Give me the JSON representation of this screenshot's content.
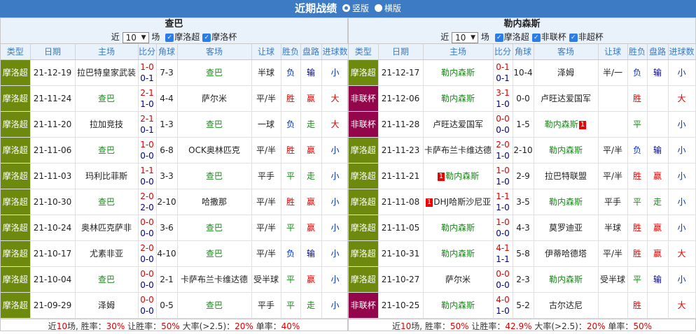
{
  "title": "近期战绩",
  "layout_opts": [
    "竖版",
    "横版"
  ],
  "layout_selected": 0,
  "labels": {
    "near": "近",
    "chang": "场"
  },
  "columns": [
    "类型",
    "日期",
    "主场",
    "比分",
    "角球",
    "客场",
    "让球",
    "胜负",
    "盘路",
    "进球数"
  ],
  "colors": {
    "mocha": "#6d8a0f",
    "nonleague": "#94064b",
    "win": "#e00000",
    "draw": "#1a8a1a",
    "lose": "#0033cc"
  },
  "left": {
    "team": "查巴",
    "count": "10",
    "filters": [
      "摩洛超",
      "摩洛杯"
    ],
    "rows": [
      {
        "type": "摩洛超",
        "date": "21-12-19",
        "home": "拉巴特皇家武装",
        "ft": "1-0",
        "ht": "0-1",
        "ftc": "red",
        "htc": "navy",
        "corner": "7-3",
        "away": "查巴",
        "hc": "",
        "awc": "green",
        "handicap": "半球",
        "wl": "负",
        "wlc": "blue",
        "pan": "输",
        "panc": "navy",
        "goals": "小",
        "goalsc": "blue"
      },
      {
        "type": "摩洛超",
        "date": "21-11-24",
        "home": "查巴",
        "ft": "2-1",
        "ht": "1-0",
        "ftc": "red",
        "htc": "navy",
        "corner": "4-4",
        "away": "萨尔米",
        "hc": "green",
        "awc": "",
        "handicap": "平/半",
        "wl": "胜",
        "wlc": "red",
        "pan": "赢",
        "panc": "red",
        "goals": "大",
        "goalsc": "red"
      },
      {
        "type": "摩洛超",
        "date": "21-11-20",
        "home": "拉加竞技",
        "ft": "2-1",
        "ht": "0-1",
        "ftc": "red",
        "htc": "navy",
        "corner": "1-3",
        "away": "查巴",
        "hc": "",
        "awc": "green",
        "handicap": "一球",
        "wl": "负",
        "wlc": "blue",
        "pan": "走",
        "panc": "green",
        "goals": "大",
        "goalsc": "red"
      },
      {
        "type": "摩洛超",
        "date": "21-11-06",
        "home": "查巴",
        "ft": "1-0",
        "ht": "0-0",
        "ftc": "red",
        "htc": "navy",
        "corner": "6-8",
        "away": "OCK奥林匹克",
        "hc": "green",
        "awc": "",
        "handicap": "平/半",
        "wl": "胜",
        "wlc": "red",
        "pan": "赢",
        "panc": "red",
        "goals": "小",
        "goalsc": "blue"
      },
      {
        "type": "摩洛超",
        "date": "21-11-03",
        "home": "玛利比菲斯",
        "ft": "1-1",
        "ht": "0-0",
        "ftc": "red",
        "htc": "navy",
        "corner": "3-3",
        "away": "查巴",
        "hc": "",
        "awc": "green",
        "handicap": "平手",
        "wl": "平",
        "wlc": "green",
        "pan": "走",
        "panc": "green",
        "goals": "小",
        "goalsc": "blue"
      },
      {
        "type": "摩洛超",
        "date": "21-10-30",
        "home": "查巴",
        "ft": "2-0",
        "ht": "2-0",
        "ftc": "red",
        "htc": "navy",
        "corner": "2-10",
        "away": "哈撒那",
        "hc": "green",
        "awc": "",
        "handicap": "平/半",
        "wl": "胜",
        "wlc": "red",
        "pan": "赢",
        "panc": "red",
        "goals": "小",
        "goalsc": "blue"
      },
      {
        "type": "摩洛超",
        "date": "21-10-24",
        "home": "奥林匹克萨非",
        "ft": "0-0",
        "ht": "0-0",
        "ftc": "red",
        "htc": "navy",
        "corner": "3-6",
        "away": "查巴",
        "hc": "",
        "awc": "green",
        "handicap": "平/半",
        "wl": "平",
        "wlc": "green",
        "pan": "赢",
        "panc": "red",
        "goals": "小",
        "goalsc": "blue"
      },
      {
        "type": "摩洛超",
        "date": "21-10-17",
        "home": "尤素非亚",
        "ft": "2-0",
        "ht": "0-0",
        "ftc": "red",
        "htc": "navy",
        "corner": "4-10",
        "away": "查巴",
        "hc": "",
        "awc": "green",
        "handicap": "平/半",
        "wl": "负",
        "wlc": "blue",
        "pan": "输",
        "panc": "navy",
        "goals": "小",
        "goalsc": "blue"
      },
      {
        "type": "摩洛超",
        "date": "21-10-04",
        "home": "查巴",
        "ft": "0-0",
        "ht": "0-0",
        "ftc": "red",
        "htc": "navy",
        "corner": "2-1",
        "away": "卡萨布兰卡维达德",
        "hc": "green",
        "awc": "",
        "handicap": "受半球",
        "wl": "平",
        "wlc": "green",
        "pan": "赢",
        "panc": "red",
        "goals": "小",
        "goalsc": "blue"
      },
      {
        "type": "摩洛超",
        "date": "21-09-29",
        "home": "泽姆",
        "ft": "0-0",
        "ht": "0-0",
        "ftc": "red",
        "htc": "navy",
        "corner": "0-5",
        "away": "查巴",
        "hc": "",
        "awc": "green",
        "handicap": "平手",
        "wl": "平",
        "wlc": "green",
        "pan": "走",
        "panc": "green",
        "goals": "小",
        "goalsc": "blue"
      }
    ],
    "footer": {
      "p1": "近",
      "n": "10",
      "p2": "场, 胜率：",
      "win": "30%",
      "p3": "让胜率：",
      "hwin": "50%",
      "p4": "大率(>2.5)：",
      "big": "20%",
      "p5": "单率：",
      "odd": "40%"
    }
  },
  "right": {
    "team": "勒内森斯",
    "count": "10",
    "filters": [
      "摩洛超",
      "非联杯",
      "非超杯"
    ],
    "rows": [
      {
        "type": "摩洛超",
        "date": "21-12-17",
        "home": "勒内森斯",
        "ft": "0-1",
        "ht": "0-1",
        "ftc": "red",
        "htc": "navy",
        "corner": "10-4",
        "away": "泽姆",
        "hc": "green",
        "awc": "",
        "handicap": "半/一",
        "wl": "负",
        "wlc": "blue",
        "pan": "输",
        "panc": "navy",
        "goals": "小",
        "goalsc": "blue"
      },
      {
        "type": "非联杯",
        "date": "21-12-06",
        "home": "勒内森斯",
        "ft": "3-1",
        "ht": "1-0",
        "ftc": "red",
        "htc": "navy",
        "corner": "0-0",
        "away": "卢旺达爱国军",
        "hc": "green",
        "awc": "",
        "handicap": "",
        "wl": "胜",
        "wlc": "red",
        "pan": "",
        "panc": "",
        "goals": "大",
        "goalsc": "red"
      },
      {
        "type": "非联杯",
        "date": "21-11-28",
        "home": "卢旺达爱国军",
        "ft": "0-0",
        "ht": "0-0",
        "ftc": "red",
        "htc": "navy",
        "corner": "1-5",
        "away": "勒内森斯",
        "hc": "",
        "awc": "green",
        "awr": "1",
        "handicap": "",
        "wl": "平",
        "wlc": "green",
        "pan": "",
        "panc": "",
        "goals": "小",
        "goalsc": "blue"
      },
      {
        "type": "摩洛超",
        "date": "21-11-23",
        "home": "卡萨布兰卡维达德",
        "ft": "2-0",
        "ht": "1-0",
        "ftc": "red",
        "htc": "navy",
        "corner": "2-10",
        "away": "勒内森斯",
        "hc": "",
        "awc": "green",
        "handicap": "平/半",
        "wl": "负",
        "wlc": "blue",
        "pan": "输",
        "panc": "navy",
        "goals": "小",
        "goalsc": "blue"
      },
      {
        "type": "摩洛超",
        "date": "21-11-21",
        "home": "勒内森斯",
        "hr": "1",
        "ft": "1-0",
        "ht": "1-0",
        "ftc": "red",
        "htc": "navy",
        "corner": "2-9",
        "away": "拉巴特联盟",
        "hc": "green",
        "awc": "",
        "handicap": "平/半",
        "wl": "胜",
        "wlc": "red",
        "pan": "赢",
        "panc": "red",
        "goals": "小",
        "goalsc": "blue"
      },
      {
        "type": "摩洛超",
        "date": "21-11-08",
        "home": "DHJ哈斯沙尼亚",
        "hr": "1",
        "ft": "1-1",
        "ht": "1-0",
        "ftc": "red",
        "htc": "navy",
        "corner": "3-5",
        "away": "勒内森斯",
        "hc": "",
        "awc": "green",
        "handicap": "平手",
        "wl": "平",
        "wlc": "green",
        "pan": "走",
        "panc": "green",
        "goals": "小",
        "goalsc": "blue"
      },
      {
        "type": "摩洛超",
        "date": "21-11-05",
        "home": "勒内森斯",
        "ft": "1-0",
        "ht": "0-0",
        "ftc": "red",
        "htc": "navy",
        "corner": "4-3",
        "away": "莫罗迪亚",
        "hc": "green",
        "awc": "",
        "handicap": "半球",
        "wl": "胜",
        "wlc": "red",
        "pan": "赢",
        "panc": "red",
        "goals": "小",
        "goalsc": "blue"
      },
      {
        "type": "摩洛超",
        "date": "21-10-31",
        "home": "勒内森斯",
        "ft": "4-1",
        "ht": "1-1",
        "ftc": "red",
        "htc": "navy",
        "corner": "5-8",
        "away": "伊蒂哈德塔",
        "hc": "green",
        "awc": "",
        "handicap": "平/半",
        "wl": "胜",
        "wlc": "red",
        "pan": "赢",
        "panc": "red",
        "goals": "大",
        "goalsc": "red"
      },
      {
        "type": "摩洛超",
        "date": "21-10-27",
        "home": "萨尔米",
        "ft": "0-0",
        "ht": "0-0",
        "ftc": "red",
        "htc": "navy",
        "corner": "2-3",
        "away": "勒内森斯",
        "hc": "",
        "awc": "green",
        "handicap": "受半球",
        "wl": "平",
        "wlc": "green",
        "pan": "输",
        "panc": "navy",
        "goals": "小",
        "goalsc": "blue"
      },
      {
        "type": "非联杯",
        "date": "21-10-25",
        "home": "勒内森斯",
        "ft": "4-0",
        "ht": "1-0",
        "ftc": "red",
        "htc": "navy",
        "corner": "5-2",
        "away": "古尔达尼",
        "hc": "green",
        "awc": "",
        "handicap": "",
        "wl": "胜",
        "wlc": "red",
        "pan": "",
        "panc": "",
        "goals": "大",
        "goalsc": "red"
      }
    ],
    "footer": {
      "p1": "近",
      "n": "10",
      "p2": "场, 胜率：",
      "win": "50%",
      "p3": "让胜率：",
      "hwin": "42.9%",
      "p4": "大率(>2.5)：",
      "big": "20%",
      "p5": "单率：",
      "odd": "50%"
    }
  }
}
